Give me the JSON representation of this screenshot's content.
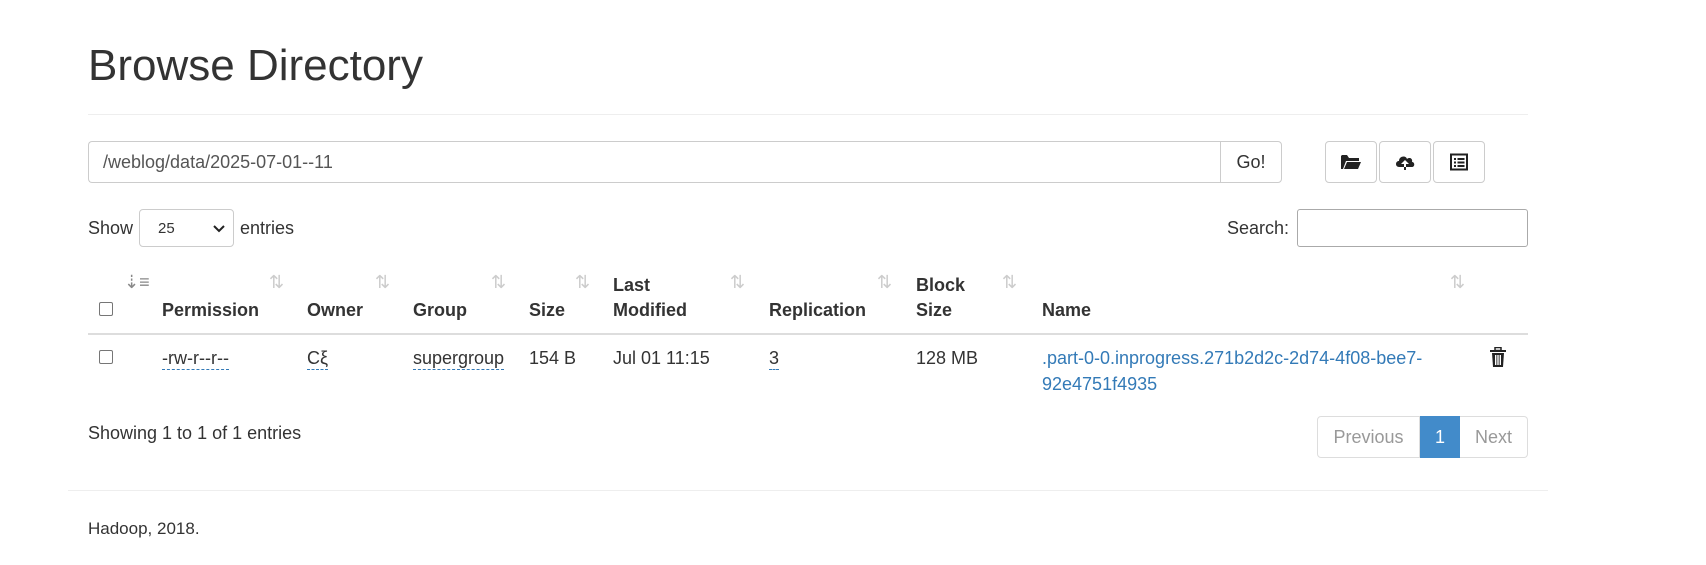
{
  "page": {
    "title": "Browse Directory"
  },
  "path_bar": {
    "path_value": "/weblog/data/2025-07-01--11",
    "go_label": "Go!"
  },
  "toolbar": {
    "icons": [
      "folder-open-icon",
      "cloud-upload-icon",
      "list-icon"
    ]
  },
  "length_control": {
    "show_label": "Show",
    "selected": "25",
    "entries_label": "entries"
  },
  "search": {
    "label": "Search:",
    "value": ""
  },
  "table": {
    "columns": {
      "permission": "Permission",
      "owner": "Owner",
      "group": "Group",
      "size": "Size",
      "last_modified_1": "Last",
      "last_modified_2": "Modified",
      "replication": "Replication",
      "block_size_1": "Block",
      "block_size_2": "Size",
      "name": "Name"
    },
    "rows": [
      {
        "permission": "-rw-r--r--",
        "owner": "Cξ",
        "group": "supergroup",
        "size": "154 B",
        "last_modified": "Jul 01 11:15",
        "replication": "3",
        "block_size": "128 MB",
        "name_line1": ".part-0-0.inprogress.271b2d2c-2d74-4f08-bee7-",
        "name_line2": "92e4751f4935"
      }
    ]
  },
  "info": {
    "text": "Showing 1 to 1 of 1 entries"
  },
  "pagination": {
    "previous": "Previous",
    "current": "1",
    "next": "Next"
  },
  "footer": {
    "text": "Hadoop, 2018."
  },
  "colors": {
    "link": "#337ab7",
    "active_page": "#428bca",
    "border": "#cccccc"
  }
}
